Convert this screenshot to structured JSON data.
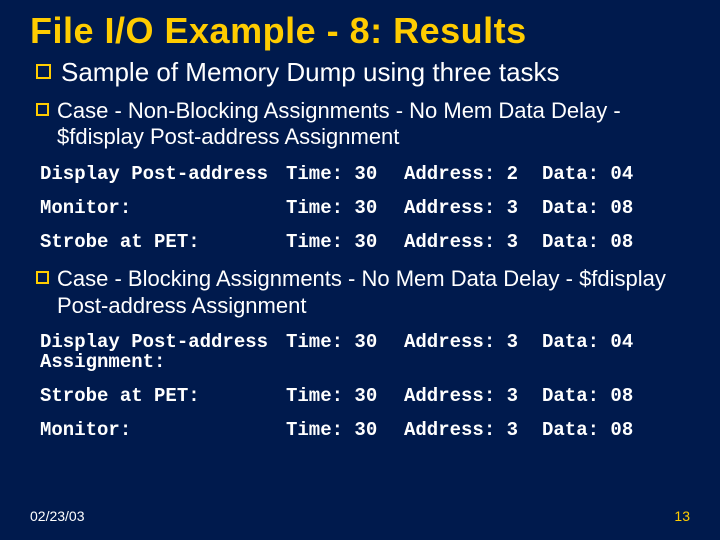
{
  "title": "File I/O Example - 8: Results",
  "main_bullet": "Sample of Memory Dump using three tasks",
  "case1": {
    "heading": "Case - Non-Blocking Assignments - No Mem Data Delay - $fdisplay Post-address Assignment",
    "rows": [
      {
        "label": "Display Post-address",
        "time": "Time: 30",
        "addr": "Address: 2",
        "data": "Data: 04"
      },
      {
        "label": "Monitor:",
        "time": "Time: 30",
        "addr": "Address: 3",
        "data": "Data: 08"
      },
      {
        "label": "Strobe at PET:",
        "time": "Time: 30",
        "addr": "Address: 3",
        "data": "Data: 08"
      }
    ]
  },
  "case2": {
    "heading": "Case - Blocking Assignments - No Mem Data Delay - $fdisplay Post-address Assignment",
    "rows": [
      {
        "label": "Display Post-address Assignment:",
        "time": "Time: 30",
        "addr": "Address: 3",
        "data": "Data: 04"
      },
      {
        "label": "Strobe at PET:",
        "time": "Time: 30",
        "addr": "Address: 3",
        "data": "Data: 08"
      },
      {
        "label": "Monitor:",
        "time": "Time: 30",
        "addr": "Address: 3",
        "data": "Data: 08"
      }
    ]
  },
  "footer": {
    "date": "02/23/03",
    "page": "13"
  }
}
